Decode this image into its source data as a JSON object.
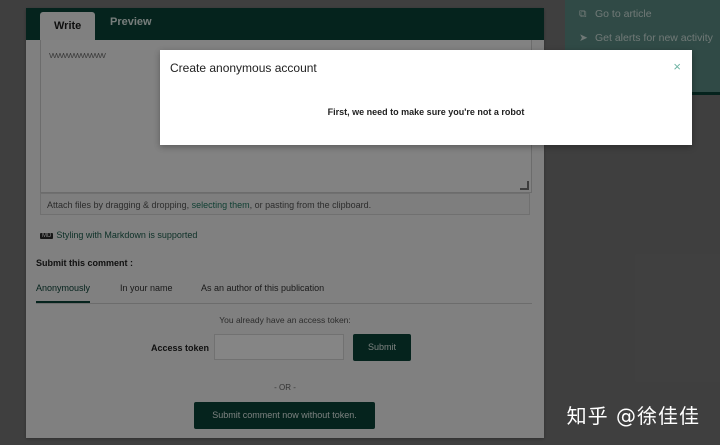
{
  "editor": {
    "tab_write": "Write",
    "tab_preview": "Preview",
    "text": "vvvvvvvvvvvvvvvv",
    "attach_prefix": "Attach files by dragging & dropping, ",
    "attach_link": "selecting them",
    "attach_suffix": ", or pasting from the clipboard.",
    "markdown_badge": "MD",
    "markdown_note": "Styling with Markdown is supported"
  },
  "submit": {
    "label": "Submit this comment :",
    "modes": [
      "Anonymously",
      "In your name",
      "As an author of this publication"
    ],
    "active_mode": "Anonymously",
    "hint": "You already have an access token:",
    "token_label": "Access token",
    "token_value": "",
    "submit_button": "Submit",
    "or": "- OR -",
    "no_token_button": "Submit comment now without token."
  },
  "side": {
    "go_to_article": "Go to article",
    "get_alerts": "Get alerts for new activity"
  },
  "modal": {
    "title": "Create anonymous account",
    "close_glyph": "×",
    "body": "First, we need to make sure you're not a robot"
  },
  "watermark": "知乎 @徐佳佳",
  "colors": {
    "brand_dark": "#0b4438",
    "side_panel": "#5d8f86",
    "link": "#1f7a62"
  }
}
